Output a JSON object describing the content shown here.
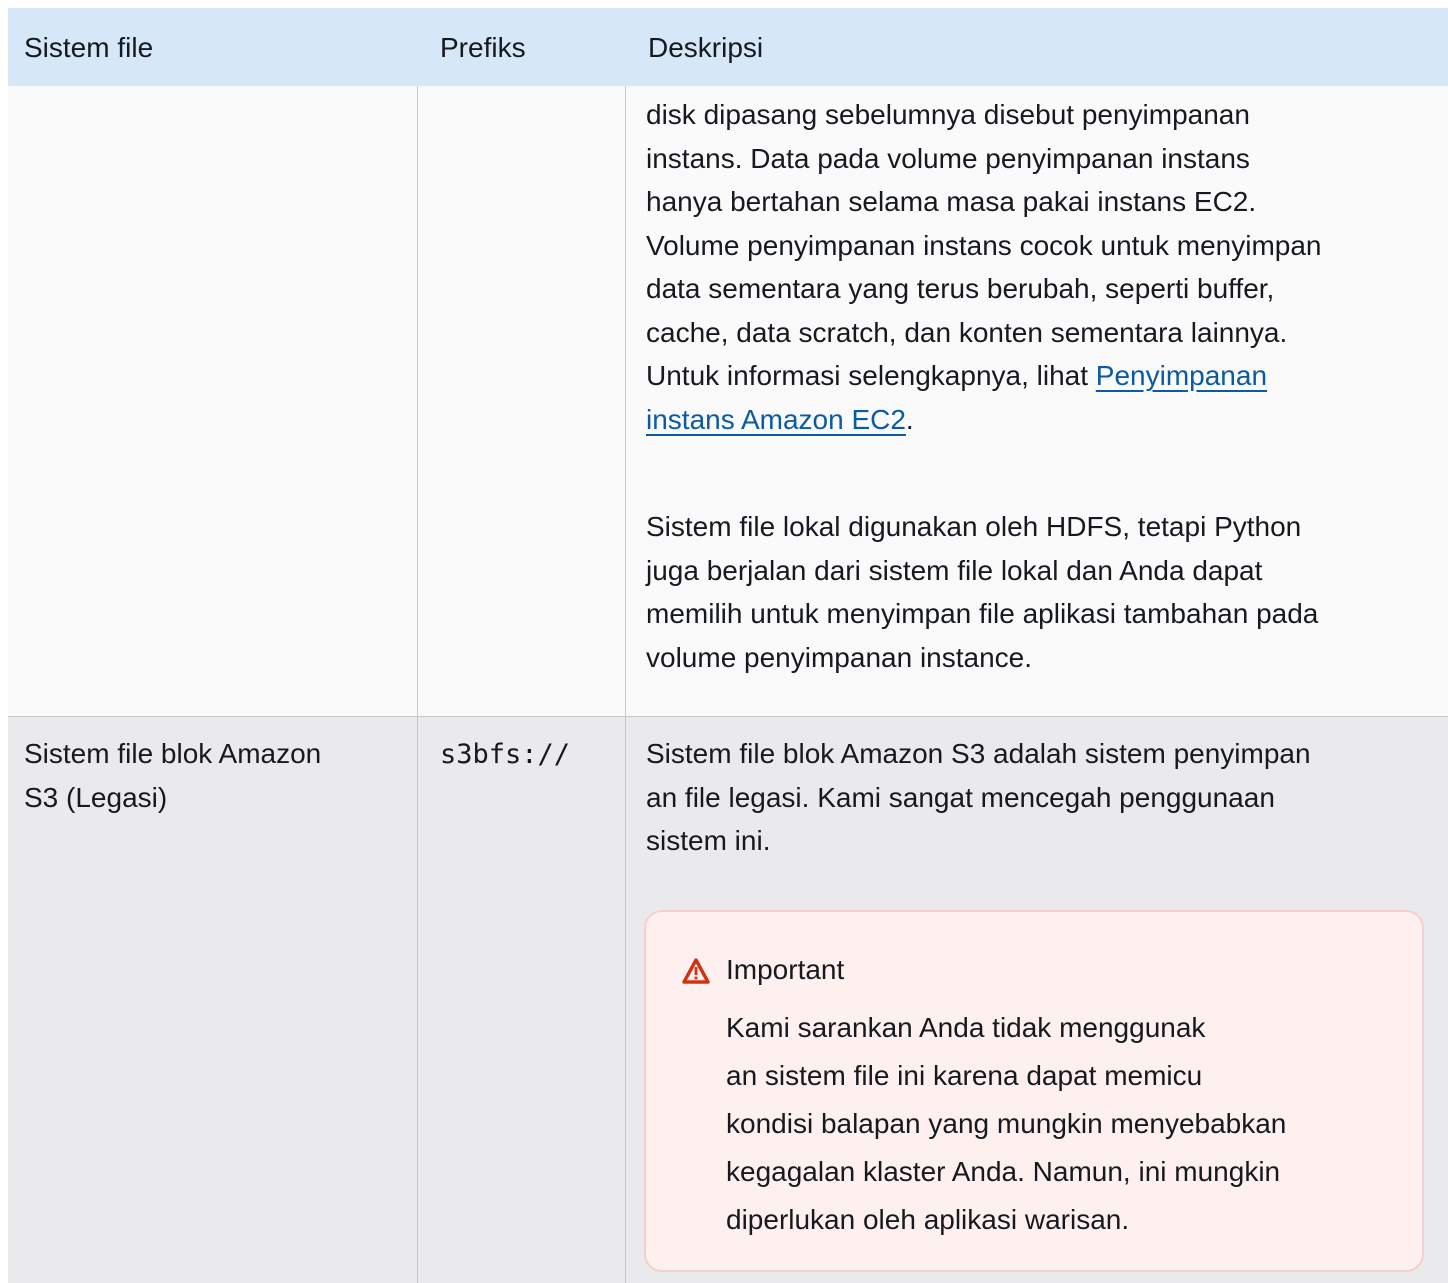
{
  "table": {
    "headers": [
      "Sistem file",
      "Prefiks",
      "Deskripsi"
    ],
    "row1": {
      "description_lines": [
        "disk dipasang sebelumnya disebut penyimpanan",
        "instans. Data pada volume penyimpanan instans",
        "hanya bertahan selama masa pakai instans EC2.",
        "Volume penyimpanan instans cocok untuk menyimpan",
        "data sementara yang terus berubah, seperti buffer,",
        "cache, data scratch, dan konten sementara lainnya."
      ],
      "more_info_prefix": "Untuk informasi selengkapnya, lihat ",
      "link_line1": "Penyimpanan",
      "link_line2": "instans Amazon EC2",
      "link_suffix": ".",
      "paragraph2_lines": [
        "Sistem file lokal digunakan oleh HDFS, tetapi Python",
        "juga berjalan dari sistem file lokal dan Anda dapat",
        "memilih untuk menyimpan file aplikasi tambahan pada",
        "volume penyimpanan instance."
      ]
    },
    "row2": {
      "filesystem_lines": [
        "Sistem file blok Amazon",
        "S3 (Legasi)"
      ],
      "prefix": "s3bfs://",
      "description_lines": [
        "Sistem file blok Amazon S3 adalah sistem penyimpan",
        "an file legasi. Kami sangat mencegah penggunaan",
        "sistem ini."
      ],
      "alert": {
        "icon": "warning-triangle-icon",
        "title": "Important",
        "body_lines": [
          "Kami sarankan Anda tidak menggunak",
          "an sistem file ini karena dapat memicu",
          "kondisi balapan yang mungkin menyebabkan",
          "kegagalan klaster Anda. Namun, ini mungkin",
          "diperlukan oleh aplikasi warisan."
        ]
      }
    }
  },
  "colors": {
    "header_bg": "#d6e7f7",
    "row_alt_bg": "#eaeaec",
    "link": "#0a5aa5",
    "alert_bg": "#fdf0ef",
    "alert_border": "#f5cfcd",
    "alert_icon": "#d13212"
  }
}
